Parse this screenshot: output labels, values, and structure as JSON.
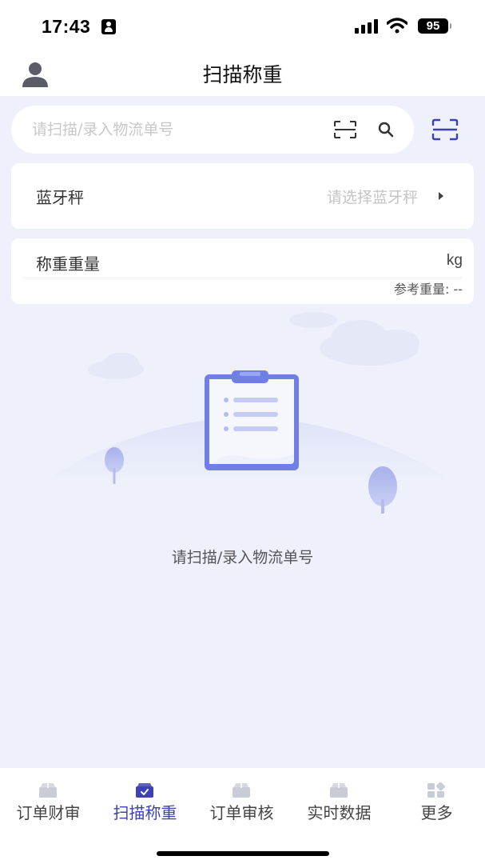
{
  "status_bar": {
    "time": "17:43",
    "battery": "95"
  },
  "header": {
    "title": "扫描称重",
    "user_icon": "user-icon"
  },
  "search": {
    "placeholder": "请扫描/录入物流单号",
    "value": ""
  },
  "bluetooth_scale": {
    "label": "蓝牙秤",
    "placeholder": "请选择蓝牙秤"
  },
  "weighing": {
    "label": "称重重量",
    "unit": "kg",
    "reference_label": "参考重量: --"
  },
  "empty_state": {
    "text": "请扫描/录入物流单号",
    "icon": "clipboard-icon"
  },
  "tabbar": {
    "items": [
      {
        "label": "订单财审",
        "icon": "box-icon"
      },
      {
        "label": "扫描称重",
        "icon": "scan-box-icon",
        "active": true
      },
      {
        "label": "订单审核",
        "icon": "box-icon"
      },
      {
        "label": "实时数据",
        "icon": "box-icon"
      },
      {
        "label": "更多",
        "icon": "grid-icon"
      }
    ]
  },
  "colors": {
    "accent": "#3d42b0",
    "background": "#eef1fb",
    "card": "#ffffff"
  }
}
